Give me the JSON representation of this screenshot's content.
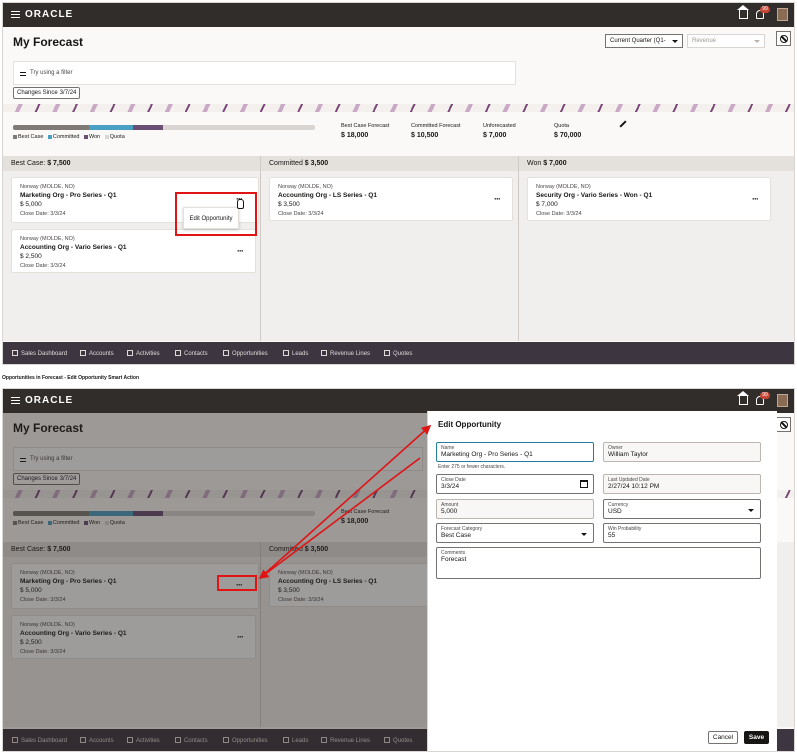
{
  "app": {
    "logo": "ORACLE",
    "notification_count": "99",
    "page_title": "My Forecast",
    "period_select": "Current Quarter (Q1-",
    "measure_select": "Revenue",
    "filter_placeholder": "Try using a filter",
    "changes_label": "Changes Since",
    "changes_date": "3/7/24"
  },
  "legend": [
    "Best Case",
    "Committed",
    "Won",
    "Quota"
  ],
  "colors": {
    "best_case": "#7f7a76",
    "committed": "#4aa0c4",
    "won": "#6a4f74",
    "accent_red": "#e01414"
  },
  "progress": {
    "best_case_pct": 25,
    "committed_pct": 14.6,
    "won_pct": 10
  },
  "metrics": [
    {
      "label": "Best Case Forecast",
      "value": "$ 18,000"
    },
    {
      "label": "Committed Forecast",
      "value": "$ 10,500"
    },
    {
      "label": "Unforecasted",
      "value": "$ 7,000"
    },
    {
      "label": "Quota",
      "value": "$ 70,000"
    }
  ],
  "columns": [
    {
      "label": "Best Case:",
      "amount": "$ 7,500"
    },
    {
      "label": "Committed",
      "amount": "$ 3,500"
    },
    {
      "label": "Won",
      "amount": "$ 7,000"
    }
  ],
  "cards": [
    {
      "account": "Norway (MOLDE, NO)",
      "name": "Marketing Org - Pro Series - Q1",
      "amount": "$ 5,000",
      "close": "Close Date: 3/3/24"
    },
    {
      "account": "Norway (MOLDE, NO)",
      "name": "Accounting Org - Vario Series - Q1",
      "amount": "$ 2,500",
      "close": "Close Date: 3/3/24"
    },
    {
      "account": "Norway (MOLDE, NO)",
      "name": "Accounting Org - LS Series - Q1",
      "amount": "$ 3,500",
      "close": "Close Date: 3/3/24"
    },
    {
      "account": "Norway (MOLDE, NO)",
      "name": "Security Org - Vario Series - Won - Q1",
      "amount": "$ 7,000",
      "close": "Close Date: 3/3/24"
    }
  ],
  "more_glyph": "···",
  "menu": {
    "edit_opportunity": "Edit Opportunity"
  },
  "nav": [
    "Sales Dashboard",
    "Accounts",
    "Activities",
    "Contacts",
    "Opportunities",
    "Leads",
    "Revenue Lines",
    "Quotes"
  ],
  "caption": "Opportunities in Forecast - Edit Opportunity Smart Action",
  "drawer": {
    "title": "Edit Opportunity",
    "name_label": "Name",
    "name_value": "Marketing Org - Pro Series - Q1",
    "name_hint": "Enter 275 or fewer characters.",
    "owner_label": "Owner",
    "owner_value": "William Taylor",
    "close_label": "Close Date",
    "close_value": "3/3/24",
    "updated_label": "Last Updated Date",
    "updated_value": "2/27/24 10:12 PM",
    "amount_label": "Amount",
    "amount_value": "5,000",
    "currency_label": "Currency",
    "currency_value": "USD",
    "category_label": "Forecast Category",
    "category_value": "Best Case",
    "probability_label": "Win Probability",
    "probability_value": "55",
    "comments_label": "Comments",
    "comments_value": "Forecast",
    "cancel": "Cancel",
    "save": "Save"
  }
}
